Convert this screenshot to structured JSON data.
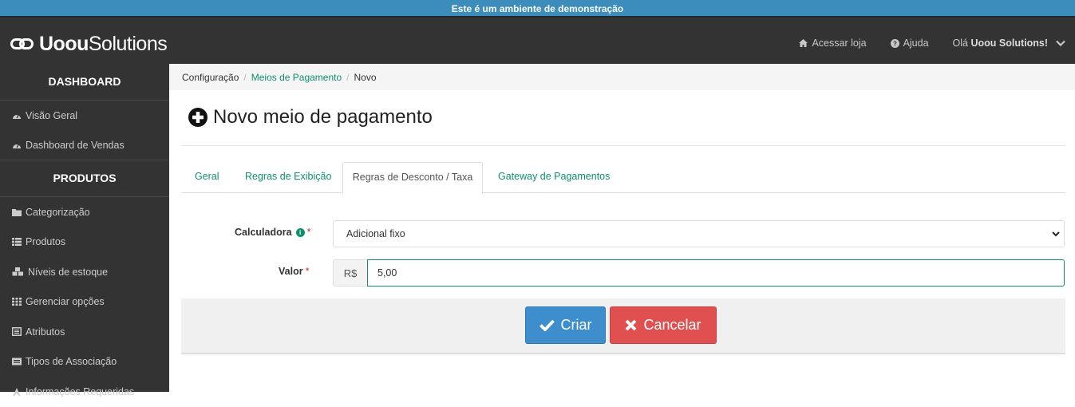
{
  "demo_banner": "Este é um ambiente de demonstração",
  "brand": {
    "bold": "Uoou",
    "light": "Solutions"
  },
  "topnav": {
    "store": "Acessar loja",
    "help": "Ajuda",
    "greeting": "Olá",
    "user": "Uoou Solutions!"
  },
  "sidebar": {
    "dashboard_header": "DASHBOARD",
    "dashboard_items": [
      {
        "label": "Visão Geral",
        "icon": "dashboard-icon"
      },
      {
        "label": "Dashboard de Vendas",
        "icon": "dashboard-icon"
      }
    ],
    "products_header": "PRODUTOS",
    "products_items": [
      {
        "label": "Categorização",
        "icon": "folder-icon"
      },
      {
        "label": "Produtos",
        "icon": "list-icon"
      },
      {
        "label": "Níveis de estoque",
        "icon": "cubes-icon"
      },
      {
        "label": "Gerenciar opções",
        "icon": "grid-icon"
      },
      {
        "label": "Atributos",
        "icon": "list-alt-icon"
      },
      {
        "label": "Tipos de Associação",
        "icon": "id-card-icon"
      },
      {
        "label": "Informações Requeridas",
        "icon": "font-icon"
      }
    ]
  },
  "breadcrumb": [
    "Configuração",
    "Meios de Pagamento",
    "Novo"
  ],
  "page_title": "Novo meio de pagamento",
  "tabs": [
    {
      "label": "Geral",
      "active": false
    },
    {
      "label": "Regras de Exibição",
      "active": false
    },
    {
      "label": "Regras de Desconto / Taxa",
      "active": true
    },
    {
      "label": "Gateway de Pagamentos",
      "active": false
    }
  ],
  "form": {
    "calculator_label": "Calculadora",
    "calculator_value": "Adicional fixo",
    "value_label": "Valor",
    "currency_prefix": "R$",
    "value": "5,00",
    "required_mark": "*"
  },
  "buttons": {
    "create": "Criar",
    "cancel": "Cancelar"
  },
  "colors": {
    "accent": "#0e8f6e",
    "banner": "#3c8dbc",
    "dark": "#333333",
    "create_button": "#3e8ecd",
    "cancel_button": "#e05050"
  }
}
